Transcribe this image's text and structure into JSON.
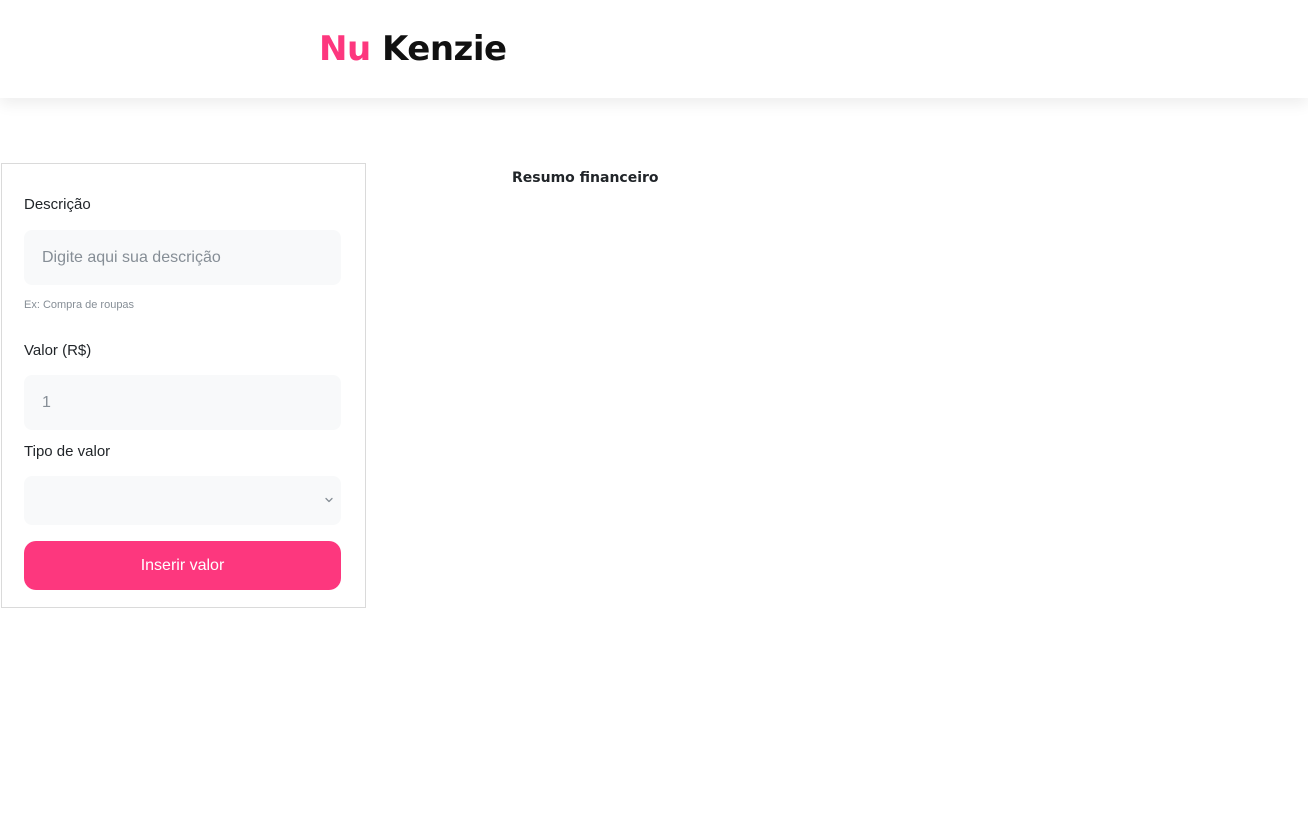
{
  "header": {
    "logo_part1": "Nu",
    "logo_part2": "Kenzie"
  },
  "form": {
    "description_label": "Descrição",
    "description_placeholder": "Digite aqui sua descrição",
    "description_value": "",
    "description_helper": "Ex: Compra de roupas",
    "value_label": "Valor (R$)",
    "value_value": "1",
    "type_label": "Tipo de valor",
    "type_selected": "",
    "submit_label": "Inserir valor"
  },
  "summary": {
    "title": "Resumo financeiro"
  },
  "icons": {
    "select_chevron": "chevron-down-icon"
  },
  "colors": {
    "brand_pink": "#fd377e",
    "input_background": "#f8f9fa",
    "text_dark": "#212529",
    "text_muted": "#868e96"
  }
}
